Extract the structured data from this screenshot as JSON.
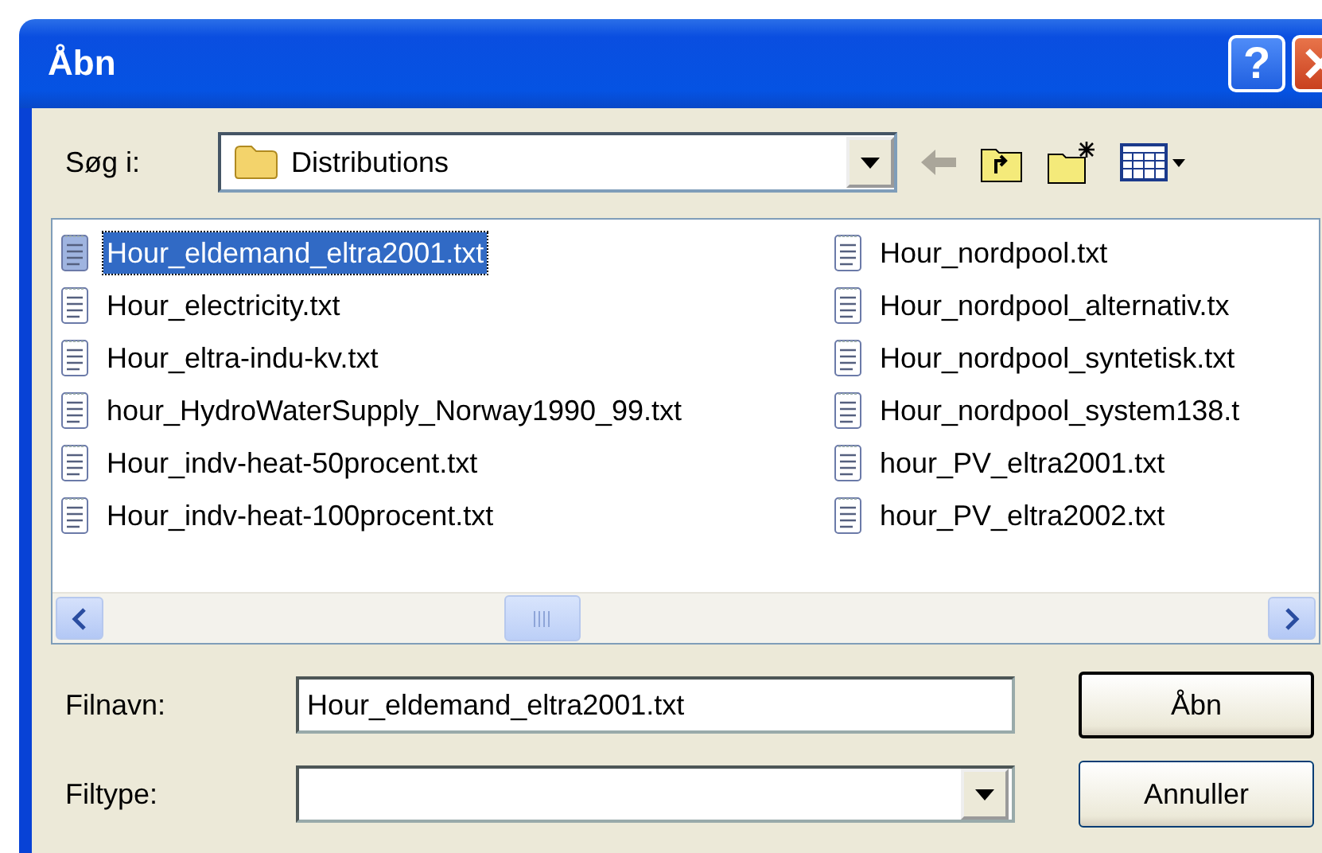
{
  "window": {
    "title": "Åbn",
    "help_button": "?"
  },
  "look_in": {
    "label": "Søg i:",
    "value": "Distributions"
  },
  "file_list": {
    "columns": [
      {
        "files": [
          {
            "name": "Hour_eldemand_eltra2001.txt",
            "selected": true
          },
          {
            "name": "Hour_electricity.txt",
            "selected": false
          },
          {
            "name": "Hour_eltra-indu-kv.txt",
            "selected": false
          },
          {
            "name": "hour_HydroWaterSupply_Norway1990_99.txt",
            "selected": false
          },
          {
            "name": "Hour_indv-heat-50procent.txt",
            "selected": false
          },
          {
            "name": "Hour_indv-heat-100procent.txt",
            "selected": false
          }
        ]
      },
      {
        "files": [
          {
            "name": "Hour_nordpool.txt",
            "selected": false
          },
          {
            "name": "Hour_nordpool_alternativ.tx",
            "selected": false
          },
          {
            "name": "Hour_nordpool_syntetisk.txt",
            "selected": false
          },
          {
            "name": "Hour_nordpool_system138.t",
            "selected": false
          },
          {
            "name": "hour_PV_eltra2001.txt",
            "selected": false
          },
          {
            "name": "hour_PV_eltra2002.txt",
            "selected": false
          }
        ]
      }
    ]
  },
  "file_name": {
    "label": "Filnavn:",
    "value": "Hour_eldemand_eltra2001.txt"
  },
  "file_type": {
    "label": "Filtype:"
  },
  "buttons": [
    {
      "label": "Åbn",
      "default": true
    },
    {
      "label": "Annuller",
      "default": false
    }
  ]
}
